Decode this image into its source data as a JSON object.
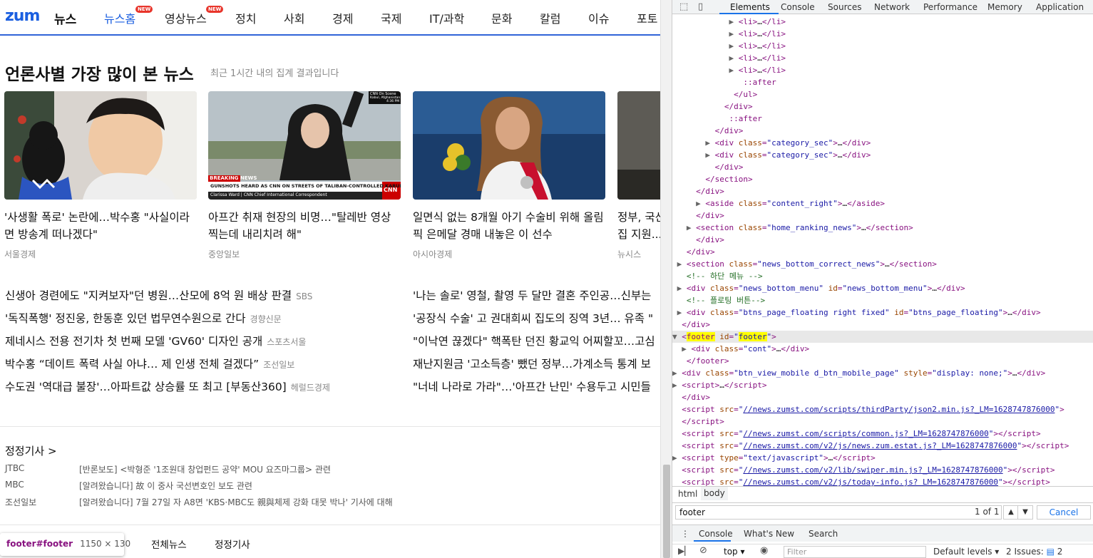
{
  "site": {
    "logo": "zum",
    "logo_sub": "뉴스",
    "nav": [
      {
        "label": "뉴스홈",
        "badge": "NEW",
        "active": true
      },
      {
        "label": "영상뉴스",
        "badge": "NEW"
      },
      {
        "label": "정치"
      },
      {
        "label": "사회"
      },
      {
        "label": "경제"
      },
      {
        "label": "국제"
      },
      {
        "label": "IT/과학"
      },
      {
        "label": "문화"
      },
      {
        "label": "칼럼"
      },
      {
        "label": "이슈"
      },
      {
        "label": "포토"
      }
    ],
    "section_title": "언론사별 가장 많이 본 뉴스",
    "section_sub": "최근 1시간 내의 집계 결과입니다",
    "cards": [
      {
        "title": "'사생활 폭로' 논란에…박수홍 \"사실이라면 방송계 떠나겠다\"",
        "source": "서울경제",
        "image": "man-with-black-cat-photo"
      },
      {
        "title": "아프간 취재 현장의 비명…\"탈레반 영상 찍는데 내리치려 해\"",
        "source": "중앙일보",
        "image": "cnn-reporter-kabul-photo",
        "overlay_top": "CNN On Scene",
        "overlay_loc": "Kabul, Afghanistan",
        "overlay_time": "4:36 PM",
        "breaking": "BREAKING NEWS",
        "ticker": "GUNSHOTS HEARD AS CNN ON STREETS OF TALIBAN-CONTROLLED KABUL",
        "reporter": "Clarissa Ward | CNN Chief International Correspondent",
        "channel": "CNN"
      },
      {
        "title": "일면식 없는 8개월 아기 수술비 위해 올림픽 은메달 경매 내놓은 이 선수",
        "source": "아시아경제",
        "image": "athlete-silver-medal-photo"
      },
      {
        "title": "정부, 국산...",
        "title_line1": "정부, 국산",
        "title_line2": "집 지원...",
        "source": "뉴시스",
        "image": "partial-photo"
      }
    ],
    "headlines_left": [
      {
        "title": "신생아 경련에도 \"지켜보자\"던 병원…산모에 8억 원 배상 판결",
        "source": "SBS"
      },
      {
        "title": "'독직폭행' 정진웅, 한동훈 있던 법무연수원으로 간다",
        "source": "경향신문"
      },
      {
        "title": "제네시스 전용 전기차 첫 번째 모델 'GV60' 디자인 공개",
        "source": "스포츠서울"
      },
      {
        "title": "박수홍 “데이트 폭력 사실 아냐… 제 인생 전체 걸겠다”",
        "source": "조선일보"
      },
      {
        "title": "수도권 '역대급 불장'…아파트값 상승률 또 최고 [부동산360]",
        "source": "헤럴드경제"
      }
    ],
    "headlines_right": [
      {
        "title": "'나는 솔로' 영철, 촬영 두 달만 결혼 주인공…신부는"
      },
      {
        "title": "'공장식 수술' 고 권대희씨 집도의 징역 3년… 유족 \""
      },
      {
        "title": "\"이낙연 끊겠다\" 핵폭탄 던진 황교익 어찌할꼬…고심"
      },
      {
        "title": "재난지원금 '고소득층' 뺐던 정부…가계소득 통계 보"
      },
      {
        "title": "\"너네 나라로 가라\"…'아프간 난민' 수용두고 시민들"
      }
    ],
    "correction_title": "정정기사 >",
    "corrections": [
      {
        "media": "JTBC",
        "text": "[반론보도] <박형준 '1조원대 창업펀드 공약' MOU 요즈마그룹> 관련"
      },
      {
        "media": "MBC",
        "text": "[알려왔습니다] 故 이 중사 국선변호인 보도 관련"
      },
      {
        "media": "조선일보",
        "text": "[알려왔습니다] 7월 27일 자 A8면 'KBS·MBC도 親與체제 강화 대못 박나' 기사에 대해"
      }
    ],
    "bottom_links": [
      "전체뉴스",
      "정정기사"
    ],
    "tooltip_name": "footer#footer",
    "tooltip_size": "1150 × 130"
  },
  "devtools": {
    "tabs": [
      "Elements",
      "Console",
      "Sources",
      "Network",
      "Performance",
      "Memory",
      "Application"
    ],
    "active_tab": "Elements",
    "breadcrumbs": [
      "html",
      "body"
    ],
    "search_value": "footer",
    "search_count": "1 of 1",
    "cancel_label": "Cancel",
    "drawer_tabs": [
      "Console",
      "What's New",
      "Search"
    ],
    "context": "top",
    "filter_placeholder": "Filter",
    "levels": "Default levels",
    "issues": "2 Issues:",
    "issues_count": "2"
  }
}
